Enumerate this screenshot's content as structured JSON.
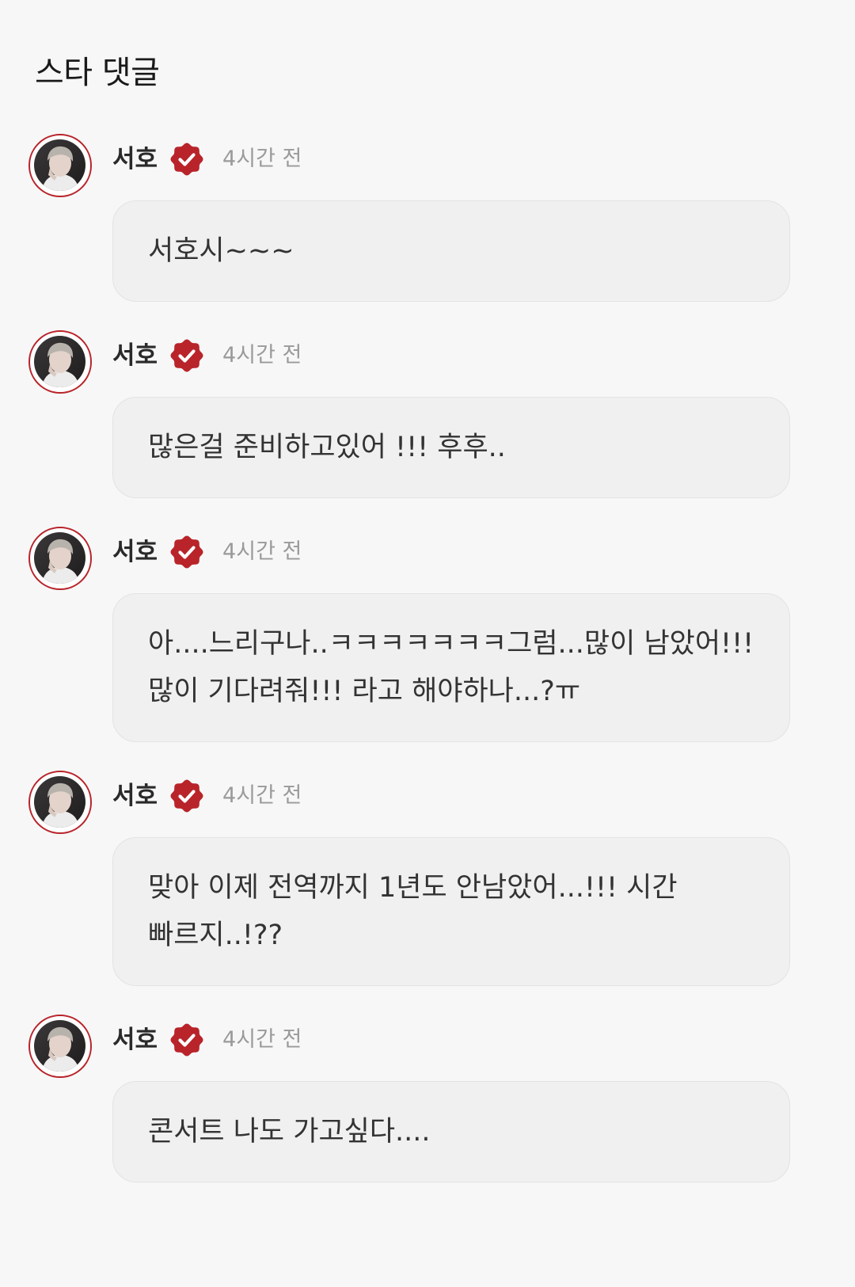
{
  "header": {
    "title": "스타 댓글"
  },
  "colors": {
    "accent": "#b8242a",
    "bubble_bg": "#f0f0f0",
    "page_bg": "#f7f7f7",
    "timestamp": "#9a9a9a"
  },
  "icons": {
    "verified": "verified-badge-icon",
    "avatar": "avatar-photo"
  },
  "comments": [
    {
      "author": "서호",
      "time": "4시간 전",
      "text": "서호시~~~"
    },
    {
      "author": "서호",
      "time": "4시간 전",
      "text": "많은걸 준비하고있어 !!! 후후.."
    },
    {
      "author": "서호",
      "time": "4시간 전",
      "text": "아....느리구나..ㅋㅋㅋㅋㅋㅋㅋ그럼...많이 남았어!!! 많이 기다려줘!!! 라고 해야하나...?ㅠ"
    },
    {
      "author": "서호",
      "time": "4시간 전",
      "text": "맞아 이제 전역까지 1년도 안남았어...!!! 시간 빠르지..!??"
    },
    {
      "author": "서호",
      "time": "4시간 전",
      "text": "콘서트 나도 가고싶다...."
    }
  ]
}
